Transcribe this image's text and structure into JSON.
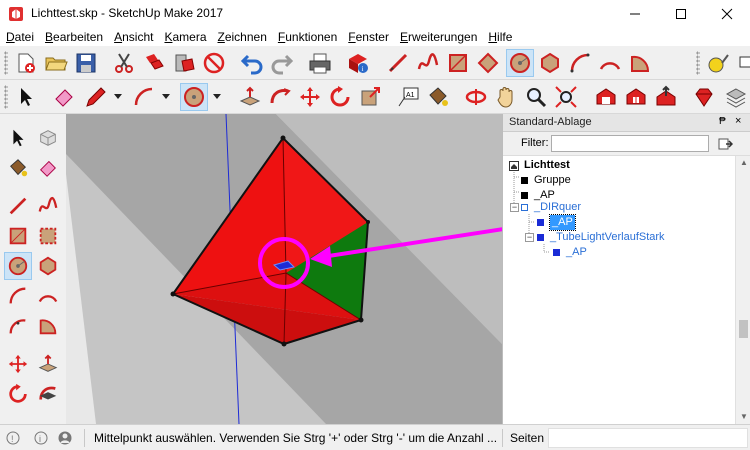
{
  "window": {
    "title": "Lichttest.skp - SketchUp Make 2017",
    "minimize_icon": "minimize-icon",
    "maximize_icon": "maximize-icon",
    "close_icon": "close-icon"
  },
  "menu": [
    "Datei",
    "Bearbeiten",
    "Ansicht",
    "Kamera",
    "Zeichnen",
    "Funktionen",
    "Fenster",
    "Erweiterungen",
    "Hilfe"
  ],
  "toolbar1": {
    "icons": [
      "new-document-icon",
      "open-folder-icon",
      "save-icon",
      "cut-icon",
      "copy-icon",
      "paste-icon",
      "erase-icon",
      "undo-icon",
      "redo-icon",
      "print-icon",
      "model-info-icon",
      "line-icon",
      "freehand-icon",
      "rectangle-icon",
      "circle-icon",
      "polygon-icon",
      "arc-icon",
      "pie-icon",
      "tape-measure-icon"
    ]
  },
  "toolbar2": {
    "icons": [
      "select-icon",
      "eraser-icon",
      "pencil-icon",
      "arc-icon",
      "circle-icon",
      "push-pull-icon",
      "follow-me-icon",
      "move-icon",
      "rotate-icon",
      "scale-icon",
      "text-icon",
      "paint-bucket-icon",
      "orbit-icon",
      "pan-icon",
      "zoom-icon",
      "zoom-extents-icon",
      "warehouse-icon",
      "extension-warehouse-icon",
      "share-model-icon",
      "ruby-icon",
      "layers-icon"
    ]
  },
  "panel": {
    "title": "Standard-Ablage",
    "pin_glyph": "₱",
    "close_glyph": "×",
    "filter_label": "Filter:",
    "filter_value": "",
    "tree": [
      {
        "label": "Lichttest",
        "level": 0,
        "root": true
      },
      {
        "label": "Gruppe",
        "level": 1,
        "color": "#000000"
      },
      {
        "label": "_AP",
        "level": 1,
        "color": "#000000"
      },
      {
        "label": "_DIRquer",
        "level": 1,
        "color": "#2a6fd6",
        "expandable": true,
        "outline": true
      },
      {
        "label": "_AP",
        "level": 2,
        "color": "#1a2bd6",
        "selected": true
      },
      {
        "label": "_TubeLightVerlaufStark",
        "level": 2,
        "color": "#1a2bd6",
        "expandable": true
      },
      {
        "label": "_AP",
        "level": 3,
        "color": "#1a2bd6"
      }
    ]
  },
  "status": {
    "text": "Mittelpunkt auswählen. Verwenden Sie Strg '+' oder Strg '-' um die Anzahl ...",
    "measure_label": "Seiten",
    "measure_value": ""
  },
  "colors": {
    "selection_blue": "#3399ff",
    "annotation_magenta": "#ff00ff",
    "face_red": "#ee0000",
    "face_green": "#007700"
  }
}
